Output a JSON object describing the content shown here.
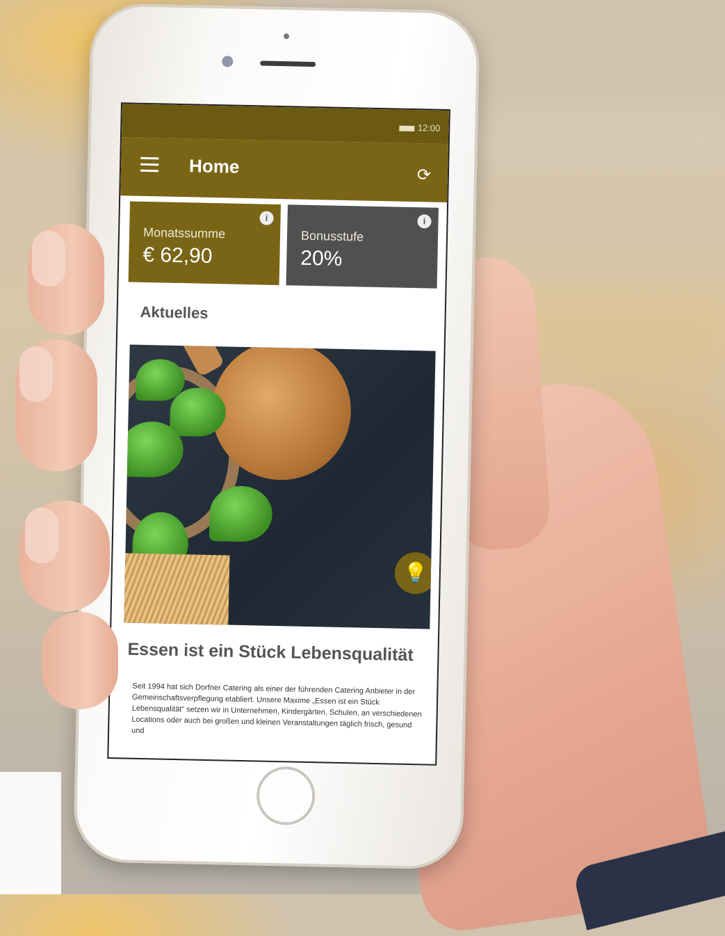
{
  "status_bar": {
    "time": "12:00"
  },
  "app_bar": {
    "title": "Home"
  },
  "tiles": [
    {
      "label": "Monatssumme",
      "value": "€ 62,90",
      "info_icon": "info-icon"
    },
    {
      "label": "Bonusstufe",
      "value": "20%",
      "info_icon": "info-icon"
    }
  ],
  "section": {
    "title": "Aktuelles"
  },
  "news": {
    "title": "Essen ist ein Stück Lebensqualität",
    "body": "Seit 1994 hat sich Dorfner Catering als einer der führenden Catering Anbieter in der Gemeinschaftsverpflegung etabliert. Unsere Maxime „Essen ist ein Stück Lebensqualität“ setzen wir in Unternehmen, Kindergärten, Schulen, an verschiedenen Locations oder auch bei großen und kleinen Veranstaltungen täglich frisch, gesund und",
    "action_icon": "lightbulb-icon"
  },
  "colors": {
    "brand": "#7a6516",
    "tile_grey": "#505050"
  }
}
